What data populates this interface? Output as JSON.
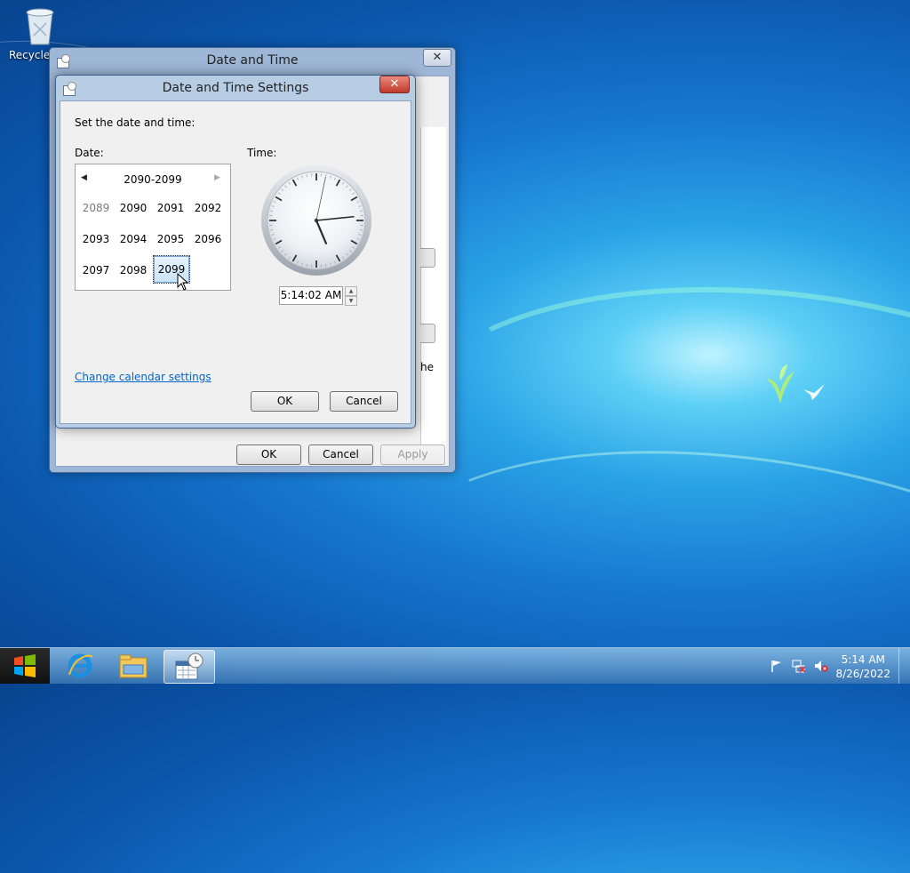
{
  "desktop": {
    "recycle_bin_label": "Recycle Bin"
  },
  "outer_window": {
    "title": "Date and Time",
    "close_label": "✕",
    "partial_text": "he",
    "ok_label": "OK",
    "cancel_label": "Cancel",
    "apply_label": "Apply"
  },
  "dialog": {
    "title": "Date and Time Settings",
    "close_label": "✕",
    "instruction": "Set the date and time:",
    "date_label": "Date:",
    "time_label": "Time:",
    "calendar": {
      "range": "2090-2099",
      "prev_arrow": "◀",
      "next_arrow": "▶",
      "years": [
        "2089",
        "2090",
        "2091",
        "2092",
        "2093",
        "2094",
        "2095",
        "2096",
        "2097",
        "2098",
        "2099"
      ],
      "selected": "2099"
    },
    "clock": {
      "hour": 5,
      "minute": 14,
      "second": 2
    },
    "time_value": "5:14:02 AM",
    "spin_up": "▲",
    "spin_down": "▼",
    "change_calendar_link": "Change calendar settings",
    "ok_label": "OK",
    "cancel_label": "Cancel"
  },
  "taskbar": {
    "time": "5:14 AM",
    "date": "8/26/2022",
    "apps": [
      "start-icon",
      "internet-explorer-icon",
      "file-explorer-icon",
      "date-time-icon"
    ],
    "tray": [
      "flag-icon",
      "network-icon",
      "speaker-muted-icon"
    ]
  }
}
